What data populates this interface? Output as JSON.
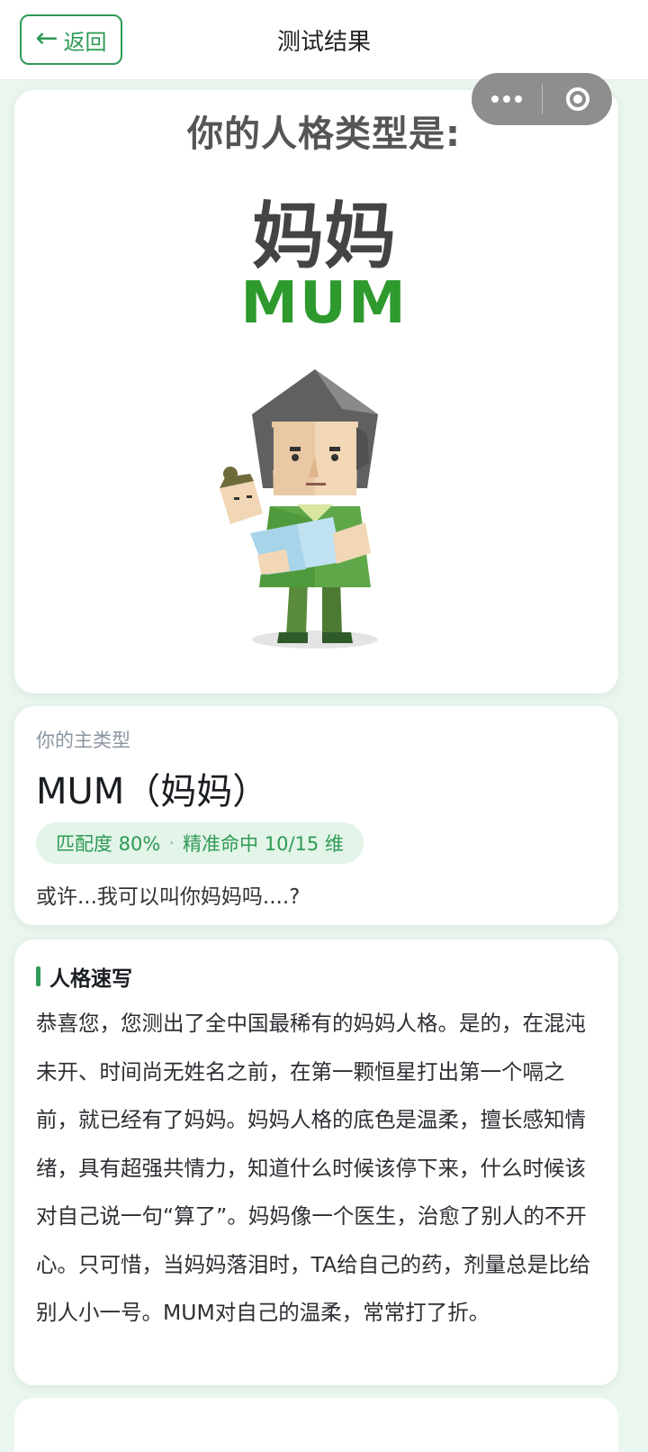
{
  "nav": {
    "back_label": "返回",
    "title": "测试结果"
  },
  "capsule": {
    "more_icon": "more-dots-icon",
    "close_icon": "target-icon"
  },
  "hero": {
    "prompt": "你的人格类型是:",
    "name": "妈妈",
    "code": "MUM",
    "code_color": "#2e9a2e"
  },
  "result": {
    "label": "你的主类型",
    "type": "MUM（妈妈）",
    "match": "匹配度 80%",
    "separator": "·",
    "hits": "精准命中 10/15 维",
    "quip": "或许...我可以叫你妈妈吗....?"
  },
  "description": {
    "title": "人格速写",
    "text": "恭喜您，您测出了全中国最稀有的妈妈人格。是的，在混沌未开、时间尚无姓名之前，在第一颗恒星打出第一个嗝之前，就已经有了妈妈。妈妈人格的底色是温柔，擅长感知情绪，具有超强共情力，知道什么时候该停下来，什么时候该对自己说一句“算了”。妈妈像一个医生，治愈了别人的不开心。只可惜，当妈妈落泪时，TA给自己的药，剂量总是比给别人小一号。MUM对自己的温柔，常常打了折。"
  },
  "colors": {
    "accent": "#2e9a55",
    "background": "#eaf6ee"
  }
}
